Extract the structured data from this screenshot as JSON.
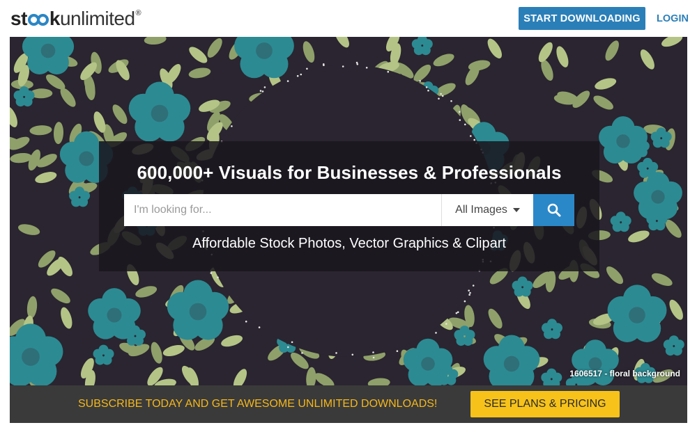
{
  "header": {
    "logo": {
      "part1": "st",
      "part2": "k",
      "part3": "unlimited",
      "reg": "®"
    },
    "start_button": "START DOWNLOADING",
    "login_link": "LOGIN"
  },
  "hero": {
    "headline": "600,000+ Visuals for Businesses & Professionals",
    "search": {
      "placeholder": "I'm looking for...",
      "value": "",
      "category_selected": "All Images",
      "button_icon": "search-icon"
    },
    "tagline": "Affordable Stock Photos, Vector Graphics & Clipart",
    "image_caption": "1606517 - floral background"
  },
  "promo": {
    "text": "SUBSCRIBE TODAY AND GET AWESOME UNLIMITED DOWNLOADS!",
    "button": "SEE PLANS & PRICING"
  },
  "colors": {
    "brand_blue": "#2b7fb8",
    "promo_yellow": "#f7c21a",
    "promo_text": "#f5b81c",
    "hero_dark": "#2a2530",
    "leaf_green": "#9aac70",
    "flower_teal": "#2c8a92"
  }
}
